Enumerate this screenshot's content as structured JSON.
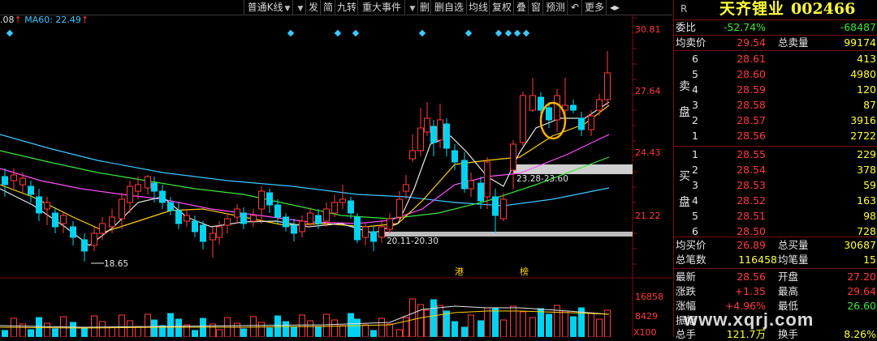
{
  "toolbar": {
    "period_label": "普通K线",
    "buttons": [
      "发",
      "简",
      "九转",
      "重大事件",
      "",
      "删",
      "删自选",
      "均线",
      "复权",
      "叠",
      "窗",
      "预测",
      "",
      "更多"
    ]
  },
  "legend": {
    "ma_tail": ".08",
    "ma60": "MA60: 22.49",
    "arrow": "↑"
  },
  "price_axis": [
    "30.81",
    "27.64",
    "24.43",
    "21.22"
  ],
  "volume_axis": [
    "16858",
    "8429",
    "X100"
  ],
  "annotations": {
    "low_label": "18.65",
    "range_low": "20.11-20.30",
    "range_high": "23.28-23.60",
    "tag_gang": "港",
    "tag_bang": "榜"
  },
  "panel": {
    "r_label": "R",
    "stock_name": "天齐锂业",
    "stock_code": "002466",
    "weibi_label": "委比",
    "weibi_value": "-52.74%",
    "weibi_diff": "-68487",
    "jmj_label": "均卖价",
    "jmj_value": "29.54",
    "zml_label": "总卖量",
    "zml_value": "99174",
    "sell_tag": [
      "卖",
      "盘"
    ],
    "sells": [
      {
        "lvl": "6",
        "price": "28.61",
        "qty": "413"
      },
      {
        "lvl": "5",
        "price": "28.60",
        "qty": "4980"
      },
      {
        "lvl": "4",
        "price": "28.59",
        "qty": "120"
      },
      {
        "lvl": "3",
        "price": "28.58",
        "qty": "87"
      },
      {
        "lvl": "2",
        "price": "28.57",
        "qty": "3916"
      },
      {
        "lvl": "1",
        "price": "28.56",
        "qty": "2722"
      }
    ],
    "buy_tag": [
      "买",
      "盘"
    ],
    "buys": [
      {
        "lvl": "1",
        "price": "28.55",
        "qty": "229"
      },
      {
        "lvl": "2",
        "price": "28.54",
        "qty": "378"
      },
      {
        "lvl": "3",
        "price": "28.53",
        "qty": "59"
      },
      {
        "lvl": "4",
        "price": "28.52",
        "qty": "163"
      },
      {
        "lvl": "5",
        "price": "28.51",
        "qty": "98"
      },
      {
        "lvl": "6",
        "price": "28.50",
        "qty": "728"
      }
    ],
    "jmrj_label": "均买价",
    "jmrj_value": "26.89",
    "zmrl_label": "总买量",
    "zmrl_value": "30687",
    "zbs_label": "总笔数",
    "zbs_value": "116458",
    "jbl_label": "均笔量",
    "jbl_value": "15",
    "zx_label": "最新",
    "zx_value": "28.56",
    "kp_label": "开盘",
    "kp_value": "27.20",
    "zd_label": "涨跌",
    "zd_value": "+1.35",
    "zg_label": "最高",
    "zg_value": "29.64",
    "zf_label": "涨幅",
    "zf_value": "+4.96%",
    "zdi_label": "最低",
    "zdi_value": "26.60",
    "zhenfu_label": "振幅",
    "zs_label": "总手",
    "zs_value": "121.7万",
    "hs_label": "换手",
    "hs_value": "8.26%"
  },
  "watermark": "www.xqrj.com",
  "colors": {
    "up": "#ff3c3c",
    "down": "#00d2f0",
    "bg": "#000000",
    "ma5": "#e6e6e6",
    "ma10": "#ffd200",
    "ma20": "#ff50ff",
    "ma30": "#3ce63c",
    "ma60": "#3cc8ff",
    "axis_red": "#ff3c3c"
  }
}
